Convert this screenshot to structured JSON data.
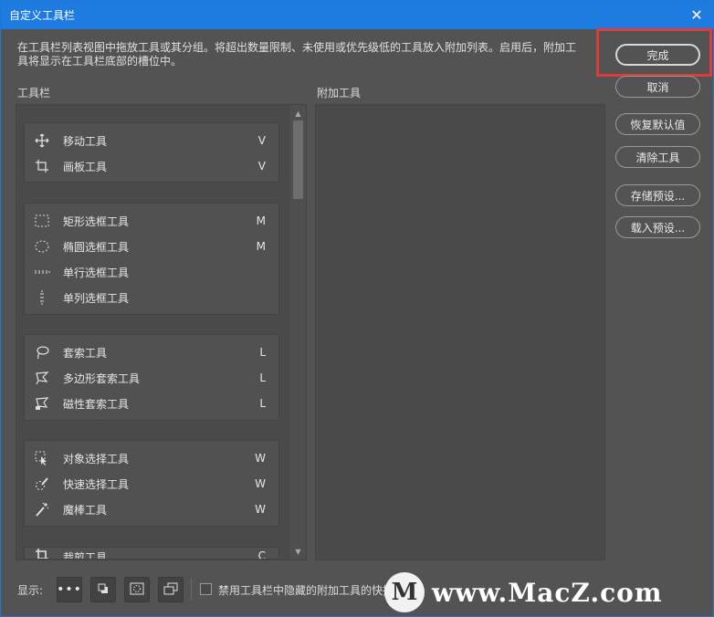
{
  "window": {
    "title": "自定义工具栏"
  },
  "description": "在工具栏列表视图中拖放工具或其分组。将超出数量限制、未使用或优先级低的工具放入附加列表。启用后，附加工具将显示在工具栏底部的槽位中。",
  "labels": {
    "toolbar": "工具栏",
    "extra": "附加工具"
  },
  "groups": [
    {
      "tools": [
        {
          "icon": "move-icon",
          "name": "移动工具",
          "key": "V"
        },
        {
          "icon": "artboard-icon",
          "name": "画板工具",
          "key": "V"
        }
      ]
    },
    {
      "tools": [
        {
          "icon": "rect-marquee-icon",
          "name": "矩形选框工具",
          "key": "M"
        },
        {
          "icon": "ellipse-marquee-icon",
          "name": "椭圆选框工具",
          "key": "M"
        },
        {
          "icon": "row-marquee-icon",
          "name": "单行选框工具",
          "key": ""
        },
        {
          "icon": "column-marquee-icon",
          "name": "单列选框工具",
          "key": ""
        }
      ]
    },
    {
      "tools": [
        {
          "icon": "lasso-icon",
          "name": "套索工具",
          "key": "L"
        },
        {
          "icon": "polygon-lasso-icon",
          "name": "多边形套索工具",
          "key": "L"
        },
        {
          "icon": "magnetic-lasso-icon",
          "name": "磁性套索工具",
          "key": "L"
        }
      ]
    },
    {
      "tools": [
        {
          "icon": "object-select-icon",
          "name": "对象选择工具",
          "key": "W"
        },
        {
          "icon": "quick-select-icon",
          "name": "快速选择工具",
          "key": "W"
        },
        {
          "icon": "magic-wand-icon",
          "name": "魔棒工具",
          "key": "W"
        }
      ]
    },
    {
      "tools": [
        {
          "icon": "crop-icon",
          "name": "裁剪工具",
          "key": "C"
        }
      ]
    }
  ],
  "buttons": {
    "done": "完成",
    "cancel": "取消",
    "restore": "恢复默认值",
    "clear": "清除工具",
    "save_preset": "存储预设...",
    "load_preset": "载入预设..."
  },
  "bottom": {
    "show_label": "显示:",
    "checkbox_label": "禁用工具栏中隐藏的附加工具的快捷键"
  },
  "watermark": {
    "text": "www.MacZ.com",
    "logo": "M"
  }
}
